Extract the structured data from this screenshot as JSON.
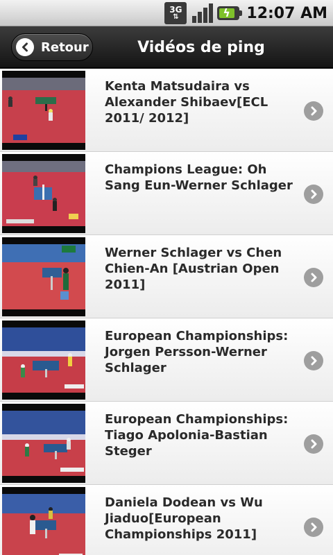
{
  "status_bar": {
    "network": "3G",
    "time": "12:07 AM"
  },
  "header": {
    "back_label": "Retour",
    "title": "Vidéos de ping"
  },
  "videos": [
    {
      "title": "Kenta Matsudaira vs Alexander Shibaev[ECL 2011/ 2012]"
    },
    {
      "title": "Champions League: Oh Sang Eun-Werner Schlager"
    },
    {
      "title": "Werner Schlager vs Chen Chien-An [Austrian Open 2011]"
    },
    {
      "title": "European Championships: Jorgen Persson-Werner Schlager"
    },
    {
      "title": "European Championships: Tiago Apolonia-Bastian Steger"
    },
    {
      "title": "Daniela Dodean vs Wu Jiaduo[European Championships 2011]"
    }
  ]
}
